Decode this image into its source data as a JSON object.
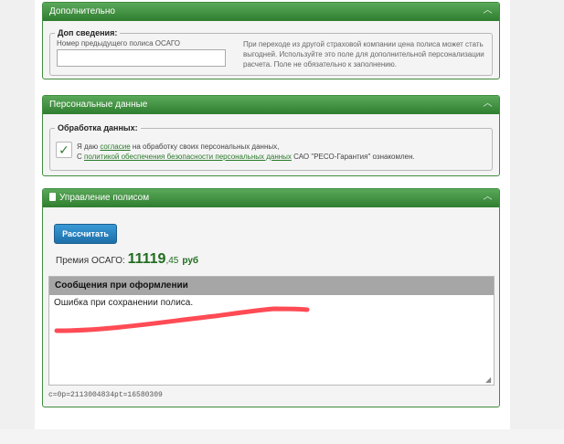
{
  "panels": {
    "additional": {
      "title": "Дополнительно",
      "collapse_icon": "chevron-up-icon",
      "legend": "Доп сведения:",
      "prev_policy_label": "Номер предыдущего полиса ОСАГО",
      "prev_policy_value": "",
      "hint": "При переходе из другой страховой компании цена полиса может стать выгодней. Используйте это поле для дополнительной персонализации расчета. Поле не обязательно к заполнению."
    },
    "personal": {
      "title": "Персональные данные",
      "collapse_icon": "chevron-up-icon",
      "legend": "Обработка данных:",
      "checkbox_checked": true,
      "consent_part1": "Я даю ",
      "consent_link1": "согласие",
      "consent_part2": " на обработку своих персональных данных,",
      "consent_part3": "С ",
      "consent_link2": "политикой обеспечения безопасности персональных данных",
      "consent_part4": " САО \"РЕСО-Гарантия\" ознакомлен."
    },
    "policy": {
      "title": "Управление полисом",
      "title_icon": "document-icon",
      "collapse_icon": "chevron-up-icon",
      "calc_button": "Рассчитать",
      "premium_label": "Премия ОСАГО: ",
      "premium_integer": "11119",
      "premium_fraction": ",45",
      "premium_currency": "руб",
      "messages_header": "Сообщения при оформлении",
      "messages_text": "Ошибка при сохранении полиса.",
      "debug_line": "c=0p=2113004834pt=16580309"
    }
  },
  "colors": {
    "panel_header": "#3f8d3f",
    "premium_green": "#1f6d1f",
    "button_blue": "#2a86c6",
    "annotation_red": "#ff4b55"
  }
}
